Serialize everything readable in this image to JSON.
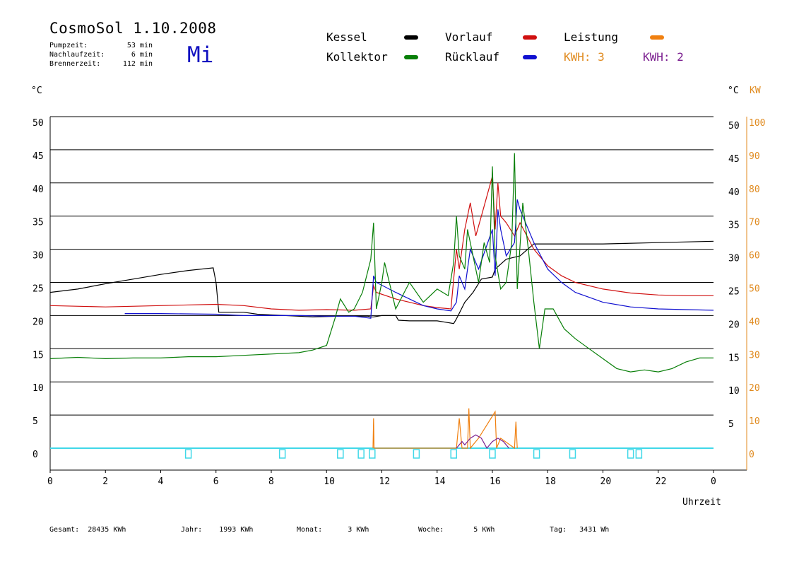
{
  "header": {
    "title": "CosmoSol 1.10.2008",
    "day": "Mi",
    "stats": [
      {
        "label": "Pumpzeit:",
        "value": "53 min"
      },
      {
        "label": "Nachlaufzeit:",
        "value": "6 min"
      },
      {
        "label": "Brennerzeit:",
        "value": "112 min"
      }
    ]
  },
  "legend": {
    "kessel": "Kessel",
    "kollektor": "Kollektor",
    "vorlauf": "Vorlauf",
    "ruecklauf": "Rücklauf",
    "leistung": "Leistung",
    "kwh_orange": "KWH: 3",
    "kwh_purple": "KWH: 2"
  },
  "colors": {
    "kessel": "#000000",
    "kollektor": "#087f08",
    "vorlauf": "#d01010",
    "ruecklauf": "#1010d0",
    "leistung": "#f08010",
    "kwh_purple": "#7a1d8f",
    "pump": "#40d8e8",
    "kw_axis": "#e08a1e"
  },
  "footer": [
    {
      "label": "Gesamt:",
      "value": "28435 KWh"
    },
    {
      "label": "Jahr:",
      "value": "1993 KWh"
    },
    {
      "label": "Monat:",
      "value": "3 KWh"
    },
    {
      "label": "Woche:",
      "value": "5 KWh"
    },
    {
      "label": "Tag:",
      "value": "3431 Wh"
    }
  ],
  "chart_data": {
    "type": "line",
    "ylabel_left": "°C",
    "ylabel_right": "°C",
    "ylabel_right2": "KW",
    "xlabel": "Uhrzeit",
    "xlim": [
      0,
      24
    ],
    "ylim": [
      0,
      50
    ],
    "y2lim": [
      0,
      100
    ],
    "x_ticks": [
      "0",
      "2",
      "4",
      "6",
      "8",
      "10",
      "12",
      "14",
      "16",
      "18",
      "20",
      "22",
      "0"
    ],
    "y_ticks_left": [
      "0",
      "5",
      "10",
      "15",
      "20",
      "25",
      "30",
      "35",
      "40",
      "45",
      "50"
    ],
    "y_ticks_right": [
      "5",
      "10",
      "15",
      "20",
      "25",
      "30",
      "35",
      "40",
      "45",
      "50"
    ],
    "y_ticks_kw": [
      "0",
      "10",
      "20",
      "30",
      "40",
      "50",
      "60",
      "70",
      "80",
      "90",
      "100"
    ],
    "grid": true,
    "series": [
      {
        "name": "Kessel",
        "color": "#000000",
        "x": [
          0,
          1,
          2,
          3,
          4,
          5,
          5.9,
          6.0,
          6.1,
          6.2,
          7.0,
          7.5,
          8.5,
          9.5,
          10.5,
          11.5,
          11.6,
          11.7,
          12.0,
          12.5,
          12.6,
          13.0,
          14.0,
          14.6,
          14.7,
          15.0,
          15.3,
          15.6,
          16.0,
          16.1,
          16.5,
          17.0,
          17.5,
          18.0,
          20.0,
          22.0,
          24.0
        ],
        "y": [
          23.5,
          24.0,
          24.8,
          25.5,
          26.2,
          26.8,
          27.2,
          25.0,
          20.5,
          20.5,
          20.5,
          20.2,
          20.0,
          19.8,
          19.9,
          19.9,
          19.8,
          19.8,
          20.0,
          20.0,
          19.3,
          19.2,
          19.2,
          18.8,
          19.5,
          22.0,
          23.5,
          25.5,
          25.8,
          27.0,
          28.5,
          29.0,
          30.8,
          30.8,
          30.8,
          31.0,
          31.2
        ]
      },
      {
        "name": "Vorlauf",
        "color": "#d01010",
        "x": [
          0,
          2,
          4,
          6,
          7,
          8,
          9,
          10,
          11,
          11.6,
          11.7,
          11.8,
          12.5,
          13.0,
          13.5,
          14.0,
          14.5,
          14.7,
          14.8,
          15.0,
          15.1,
          15.2,
          15.4,
          15.6,
          16.0,
          16.1,
          16.2,
          16.3,
          16.5,
          16.8,
          17.0,
          17.5,
          18.0,
          18.5,
          19.0,
          20.0,
          21.0,
          22.0,
          23.0,
          24.0
        ],
        "y": [
          21.5,
          21.3,
          21.5,
          21.7,
          21.5,
          21.0,
          20.8,
          20.9,
          20.8,
          21.0,
          24.5,
          23.5,
          22.5,
          22.0,
          21.5,
          21.2,
          21.0,
          30.0,
          27.0,
          33.0,
          35.0,
          37.0,
          32.0,
          35.0,
          41.0,
          33.0,
          40.0,
          35.0,
          34.0,
          32.0,
          34.0,
          30.0,
          27.5,
          26.0,
          25.0,
          24.0,
          23.4,
          23.1,
          23.0,
          23.0
        ]
      },
      {
        "name": "Rücklauf",
        "color": "#1010d0",
        "x": [
          2.7,
          4,
          6,
          7,
          8,
          9,
          10,
          11,
          11.6,
          11.7,
          11.8,
          12.5,
          13.0,
          13.5,
          14.0,
          14.5,
          14.7,
          14.8,
          15.0,
          15.2,
          15.5,
          16.0,
          16.1,
          16.2,
          16.3,
          16.5,
          16.8,
          16.9,
          17.0,
          17.5,
          18.0,
          18.5,
          19.0,
          20.0,
          21.0,
          22.0,
          23.0,
          24.0
        ],
        "y": [
          20.3,
          20.3,
          20.2,
          20.0,
          20.0,
          20.0,
          19.9,
          19.9,
          19.6,
          26.0,
          25.0,
          23.5,
          22.5,
          21.5,
          21.0,
          20.7,
          22.0,
          26.0,
          24.0,
          30.0,
          27.0,
          33.0,
          26.0,
          36.0,
          33.0,
          29.0,
          31.0,
          37.5,
          36.0,
          31.0,
          27.0,
          25.0,
          23.5,
          22.0,
          21.3,
          21.0,
          20.9,
          20.8
        ]
      },
      {
        "name": "Kollektor",
        "color": "#087f08",
        "x": [
          0,
          1,
          2,
          3,
          4,
          5,
          6,
          7,
          8,
          9,
          9.5,
          10.0,
          10.3,
          10.5,
          10.8,
          11.0,
          11.3,
          11.6,
          11.7,
          11.8,
          12.0,
          12.1,
          12.5,
          13.0,
          13.5,
          14.0,
          14.4,
          14.6,
          14.7,
          14.8,
          15.0,
          15.1,
          15.3,
          15.5,
          15.7,
          15.9,
          16.0,
          16.1,
          16.3,
          16.5,
          16.7,
          16.8,
          16.9,
          17.1,
          17.3,
          17.5,
          17.7,
          17.9,
          18.2,
          18.6,
          19.0,
          19.5,
          20.0,
          20.5,
          21.0,
          21.5,
          22.0,
          22.5,
          23.0,
          23.5,
          24.0
        ],
        "y": [
          13.5,
          13.7,
          13.5,
          13.6,
          13.6,
          13.8,
          13.8,
          14.0,
          14.2,
          14.4,
          14.8,
          15.5,
          19.5,
          22.5,
          20.5,
          21.0,
          23.5,
          28.5,
          34.0,
          21.0,
          25.0,
          28.0,
          21.0,
          25.0,
          22.0,
          24.0,
          23.0,
          28.0,
          35.0,
          29.0,
          27.0,
          33.0,
          29.0,
          25.0,
          31.0,
          28.0,
          42.5,
          29.0,
          24.0,
          25.0,
          31.0,
          44.5,
          24.0,
          37.0,
          30.0,
          22.0,
          15.0,
          21.0,
          21.0,
          18.0,
          16.5,
          15.0,
          13.5,
          12.0,
          11.5,
          11.8,
          11.5,
          12.0,
          13.0,
          13.6,
          13.6
        ]
      },
      {
        "name": "Leistung",
        "color": "#f08010",
        "axis": "kw",
        "x": [
          11.68,
          11.7,
          11.72,
          14.7,
          14.8,
          14.9,
          15.1,
          15.15,
          15.2,
          15.5,
          16.1,
          16.15,
          16.3,
          16.8,
          16.85,
          16.9
        ],
        "y": [
          0,
          9,
          0,
          0,
          9,
          0,
          0,
          12,
          0,
          3,
          11,
          0,
          3,
          0,
          8,
          0
        ]
      },
      {
        "name": "KWH: 2",
        "color": "#7a1d8f",
        "axis": "kw",
        "x": [
          14.7,
          14.9,
          15.0,
          15.2,
          15.4,
          15.6,
          15.8,
          16.0,
          16.2,
          16.4,
          16.6
        ],
        "y": [
          0,
          2,
          1,
          3,
          4,
          3,
          0,
          2,
          3,
          2,
          0
        ]
      }
    ],
    "pump_markers": [
      5.0,
      8.4,
      10.5,
      11.25,
      11.65,
      13.25,
      14.6,
      16.0,
      17.6,
      18.9,
      21.0,
      21.3
    ]
  }
}
